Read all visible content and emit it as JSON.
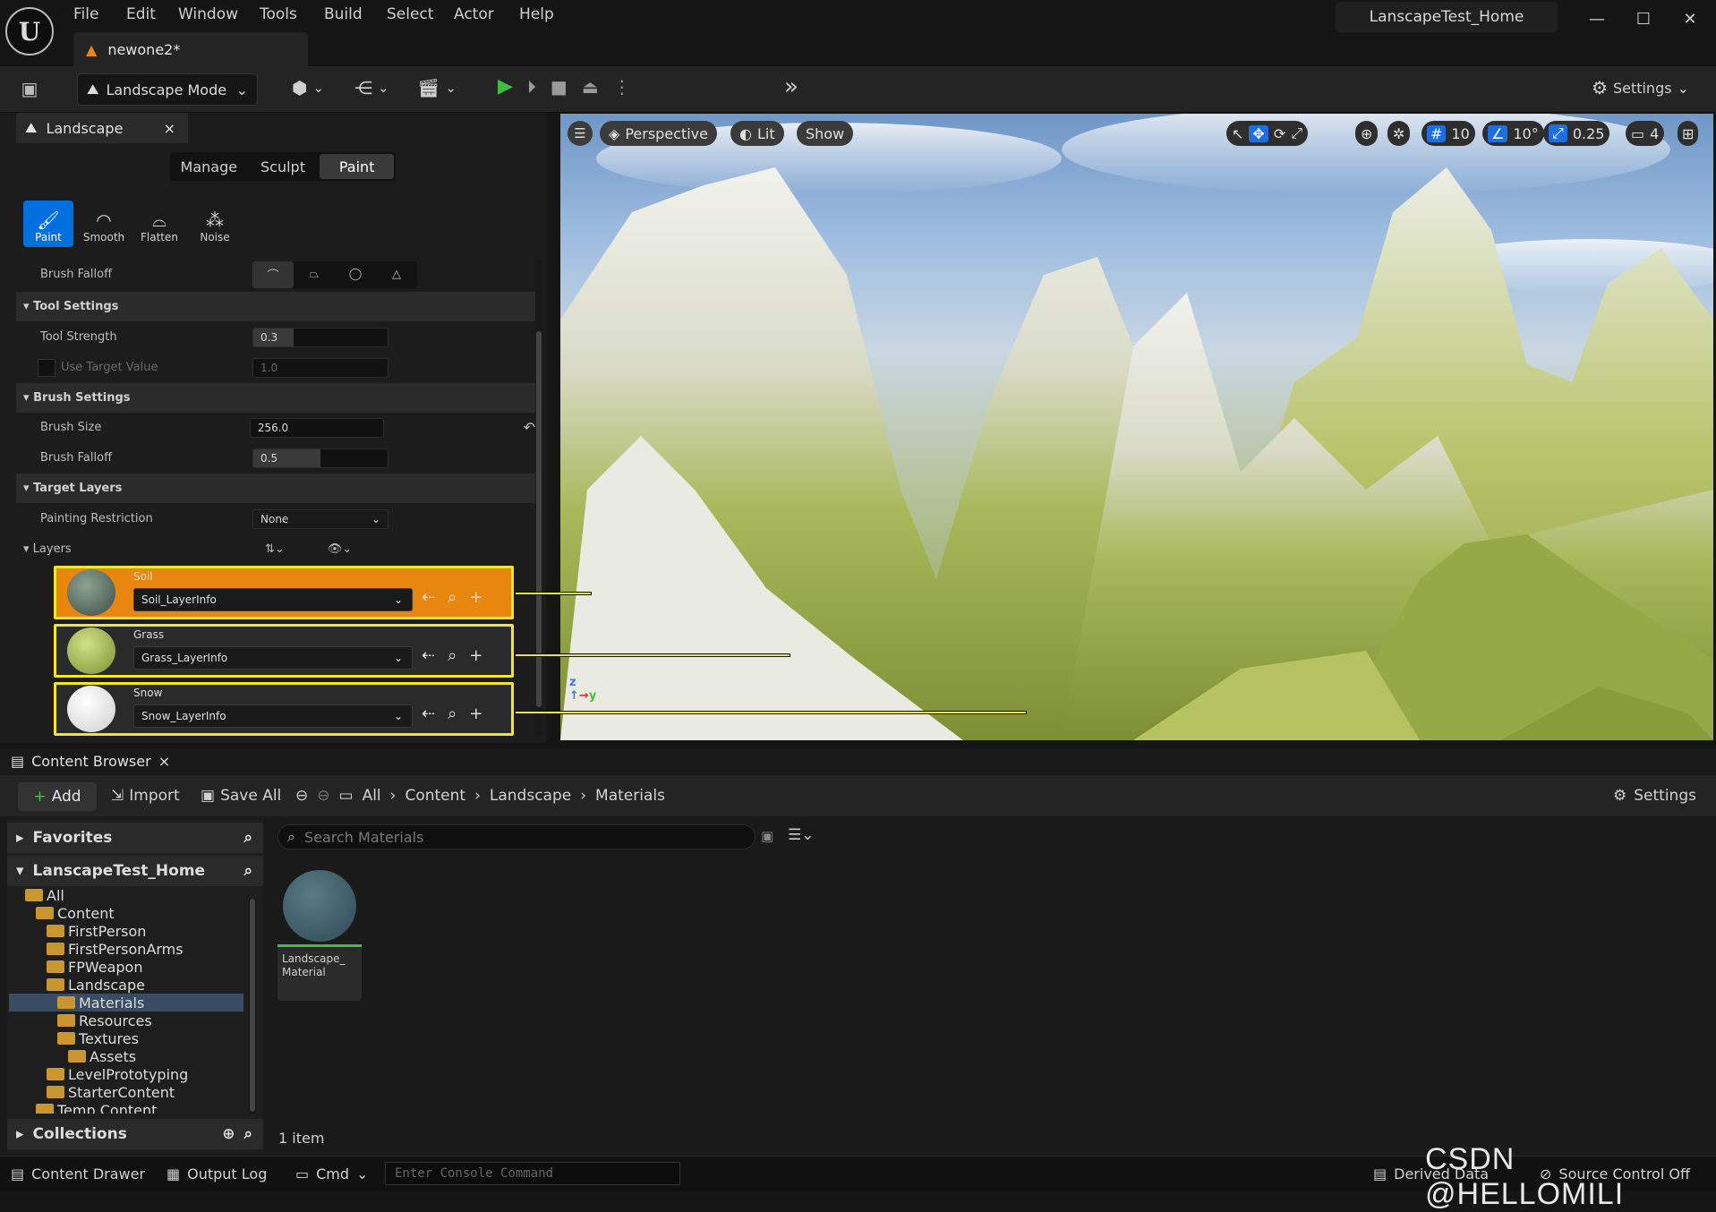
{
  "menu": [
    "File",
    "Edit",
    "Window",
    "Tools",
    "Build",
    "Select",
    "Actor",
    "Help"
  ],
  "document_tab": "newone2*",
  "project_name": "LanscapeTest_Home",
  "toolbar": {
    "mode": "Landscape Mode",
    "settings_label": "Settings"
  },
  "landscape_panel": {
    "tab_label": "Landscape",
    "modes": [
      "Manage",
      "Sculpt",
      "Paint"
    ],
    "active_mode": "Paint",
    "tools": [
      {
        "label": "Paint",
        "icon": "paint-brush-icon",
        "active": true
      },
      {
        "label": "Smooth",
        "icon": "smooth-icon",
        "active": false
      },
      {
        "label": "Flatten",
        "icon": "flatten-icon",
        "active": false
      },
      {
        "label": "Noise",
        "icon": "noise-icon",
        "active": false
      }
    ],
    "brush_falloff_label": "Brush Falloff",
    "tool_settings": {
      "header": "Tool Settings",
      "tool_strength_label": "Tool Strength",
      "tool_strength_value": "0.3",
      "tool_strength_fraction": 0.3,
      "use_target_label": "Use Target Value",
      "use_target_value": "1.0"
    },
    "brush_settings": {
      "header": "Brush Settings",
      "brush_size_label": "Brush Size",
      "brush_size_value": "256.0",
      "brush_falloff_label": "Brush Falloff",
      "brush_falloff_value": "0.5",
      "brush_falloff_fraction": 0.5
    },
    "target_layers": {
      "header": "Target Layers",
      "painting_restriction_label": "Painting Restriction",
      "painting_restriction_value": "None",
      "layers_label": "Layers"
    },
    "layers": [
      {
        "name": "Soil",
        "info": "Soil_LayerInfo",
        "selected": true,
        "thumb_color": "#5f7465"
      },
      {
        "name": "Grass",
        "info": "Grass_LayerInfo",
        "selected": false,
        "thumb_color": "#9cb24a"
      },
      {
        "name": "Snow",
        "info": "Snow_LayerInfo",
        "selected": false,
        "thumb_color": "#f1f1f1"
      }
    ]
  },
  "viewport": {
    "view_mode": "Perspective",
    "lighting": "Lit",
    "show_label": "Show",
    "grid_snap": "10",
    "rotation_snap": "10°",
    "scale_snap": "0.25",
    "camera_speed": "4"
  },
  "content_browser": {
    "tab_label": "Content Browser",
    "add_label": "Add",
    "import_label": "Import",
    "save_all_label": "Save All",
    "breadcrumbs": [
      "All",
      "Content",
      "Landscape",
      "Materials"
    ],
    "settings_label": "Settings",
    "favorites_label": "Favorites",
    "project_label": "LanscapeTest_Home",
    "collections_label": "Collections",
    "tree": [
      {
        "label": "All",
        "depth": 0
      },
      {
        "label": "Content",
        "depth": 1
      },
      {
        "label": "FirstPerson",
        "depth": 2
      },
      {
        "label": "FirstPersonArms",
        "depth": 2
      },
      {
        "label": "FPWeapon",
        "depth": 2
      },
      {
        "label": "Landscape",
        "depth": 2
      },
      {
        "label": "Materials",
        "depth": 3,
        "selected": true
      },
      {
        "label": "Resources",
        "depth": 3
      },
      {
        "label": "Textures",
        "depth": 3
      },
      {
        "label": "Assets",
        "depth": 4
      },
      {
        "label": "LevelPrototyping",
        "depth": 2
      },
      {
        "label": "StarterContent",
        "depth": 2
      },
      {
        "label": "Temp Content",
        "depth": 1
      }
    ],
    "search_placeholder": "Search Materials",
    "assets": [
      {
        "name": "Landscape_ Material"
      }
    ],
    "item_count": "1 item"
  },
  "statusbar": {
    "content_drawer": "Content Drawer",
    "output_log": "Output Log",
    "cmd": "Cmd",
    "console_placeholder": "Enter Console Command",
    "derived_data": "Derived Data",
    "source_control": "Source Control Off"
  },
  "watermark": "CSDN @HELLOMILI",
  "colors": {
    "accent_blue": "#0070e0",
    "selected_layer": "#e8870e",
    "highlight_yellow": "#f2e52a",
    "play_green": "#3fbf3f"
  }
}
